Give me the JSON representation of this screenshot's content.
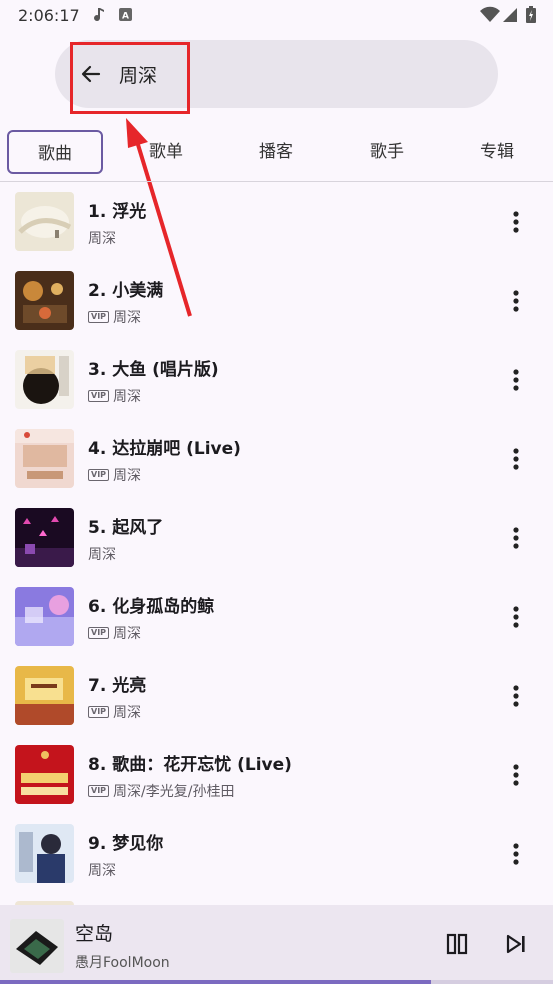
{
  "status_bar": {
    "time": "2:06:17"
  },
  "search": {
    "query": "周深"
  },
  "tabs": [
    {
      "label": "歌曲"
    },
    {
      "label": "歌单"
    },
    {
      "label": "播客"
    },
    {
      "label": "歌手"
    },
    {
      "label": "专辑"
    }
  ],
  "songs": [
    {
      "title": "1. 浮光",
      "artist": "周深",
      "vip": false
    },
    {
      "title": "2. 小美满",
      "artist": "周深",
      "vip": true
    },
    {
      "title": "3. 大鱼 (唱片版)",
      "artist": "周深",
      "vip": true
    },
    {
      "title": "4. 达拉崩吧 (Live)",
      "artist": "周深",
      "vip": true
    },
    {
      "title": "5. 起风了",
      "artist": "周深",
      "vip": false
    },
    {
      "title": "6. 化身孤岛的鲸",
      "artist": "周深",
      "vip": true
    },
    {
      "title": "7. 光亮",
      "artist": "周深",
      "vip": true
    },
    {
      "title": "8. 歌曲：花开忘忧 (Live)",
      "artist": "周深/李光复/孙桂田",
      "vip": true
    },
    {
      "title": "9. 梦见你",
      "artist": "周深",
      "vip": false
    }
  ],
  "vip_badge": "VIP",
  "player": {
    "title": "空岛",
    "artist": "愚月FoolMoon",
    "progress": 0.78
  },
  "colors": {
    "accent": "#6b5aa2",
    "annotation": "#e6262a",
    "background": "#fbf7fd"
  }
}
